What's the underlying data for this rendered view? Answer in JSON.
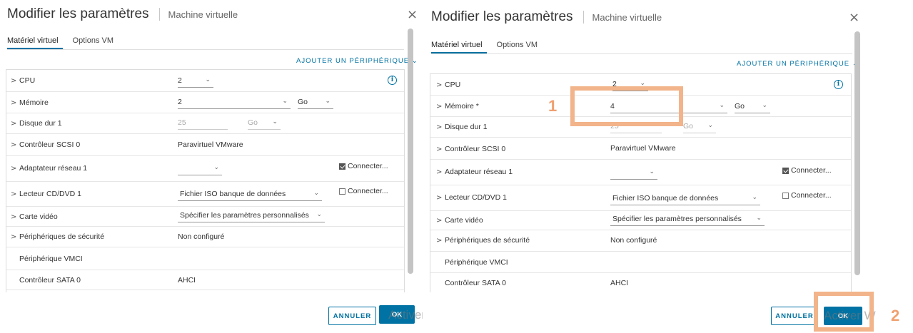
{
  "dialog": {
    "title": "Modifier les paramètres",
    "subtitle": "Machine virtuelle",
    "close_glyph": "×",
    "tabs": [
      {
        "label": "Matériel virtuel"
      },
      {
        "label": "Options VM"
      }
    ],
    "add_device_label": "AJOUTER UN PÉRIPHÉRIQUE",
    "add_device_caret": "⌄",
    "row_caret": ">",
    "select_caret": "⌄",
    "info_glyph": "i",
    "buttons": {
      "cancel": "ANNULER",
      "ok": "OK"
    },
    "watermark": "Activer W",
    "accent_color": "#0072a3"
  },
  "left": {
    "rows": [
      {
        "label": "CPU",
        "value": "2"
      },
      {
        "label": "Mémoire",
        "value": "2",
        "unit": "Go"
      },
      {
        "label": "Disque dur 1",
        "value": "25",
        "unit": "Go"
      },
      {
        "label": "Contrôleur SCSI 0",
        "value": "Paravirtuel VMware"
      },
      {
        "label": "Adaptateur réseau 1",
        "value": "",
        "checkbox": "Connecter..."
      },
      {
        "label": "Lecteur CD/DVD 1",
        "value": "Fichier ISO banque de données",
        "checkbox": "Connecter..."
      },
      {
        "label": "Carte vidéo",
        "value": "Spécifier les paramètres personnalisés"
      },
      {
        "label": "Périphériques de sécurité",
        "value": "Non configuré"
      },
      {
        "label": "Périphérique VMCI",
        "value": ""
      },
      {
        "label": "Contrôleur SATA 0",
        "value": "AHCI"
      }
    ]
  },
  "right": {
    "rows": [
      {
        "label": "CPU",
        "value": "2"
      },
      {
        "label": "Mémoire *",
        "value": "4",
        "unit": "Go"
      },
      {
        "label": "Disque dur 1",
        "value": "25",
        "unit": "Go"
      },
      {
        "label": "Contrôleur SCSI 0",
        "value": "Paravirtuel VMware"
      },
      {
        "label": "Adaptateur réseau 1",
        "value": "",
        "checkbox": "Connecter..."
      },
      {
        "label": "Lecteur CD/DVD 1",
        "value": "Fichier ISO banque de données",
        "checkbox": "Connecter..."
      },
      {
        "label": "Carte vidéo",
        "value": "Spécifier les paramètres personnalisés"
      },
      {
        "label": "Périphériques de sécurité",
        "value": "Non configuré"
      },
      {
        "label": "Périphérique VMCI",
        "value": ""
      },
      {
        "label": "Contrôleur SATA 0",
        "value": "AHCI"
      }
    ]
  },
  "annotations": {
    "step1": "1",
    "step2": "2",
    "highlight_color": "#f2b48a"
  }
}
